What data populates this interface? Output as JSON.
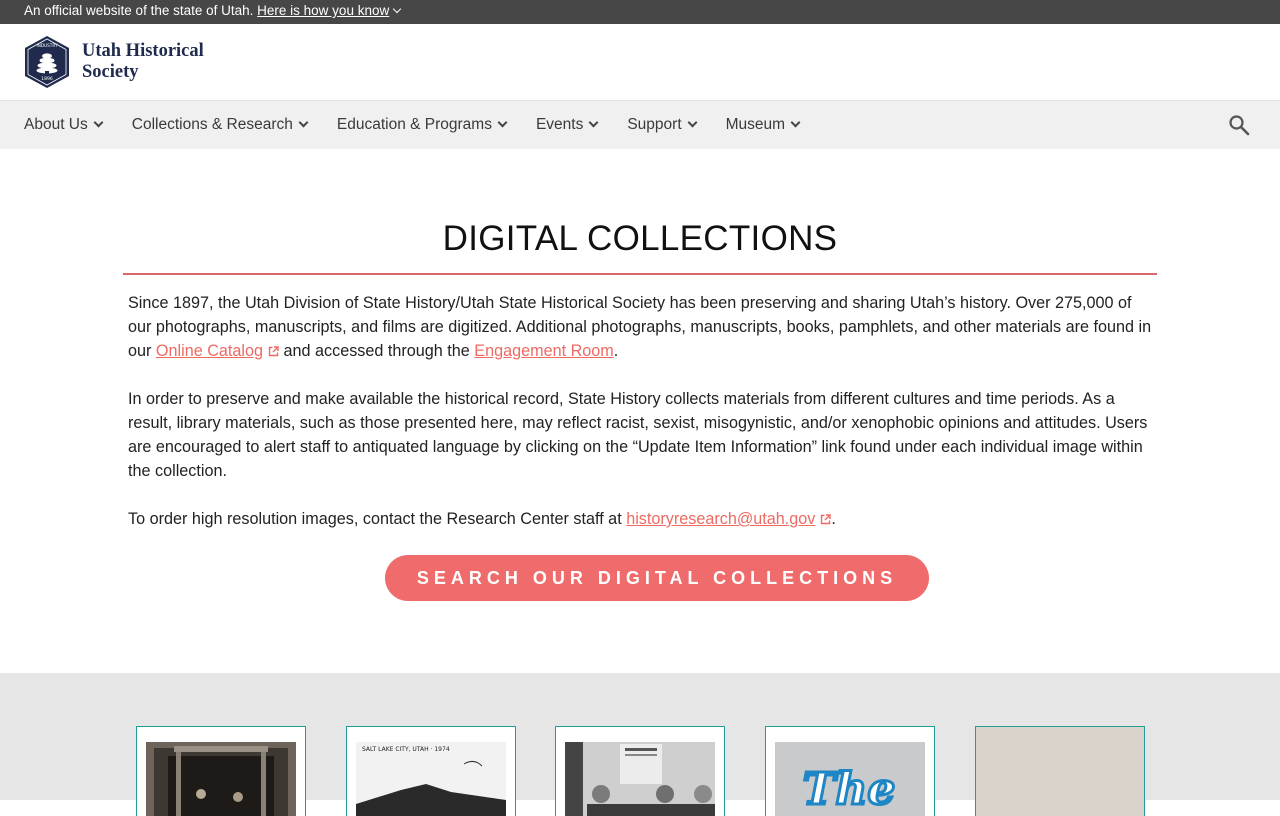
{
  "gov_banner": {
    "text": "An official website of the state of Utah.",
    "link": "Here is how you know"
  },
  "header": {
    "logo_line1": "Utah Historical",
    "logo_line2": "Society",
    "badge_top": "INDUSTRY",
    "badge_year": "1896"
  },
  "nav": {
    "items": [
      "About Us",
      "Collections & Research",
      "Education & Programs",
      "Events",
      "Support",
      "Museum"
    ],
    "search_icon": "search-icon"
  },
  "main": {
    "title": "DIGITAL COLLECTIONS",
    "p1_part1": "Since 1897, the Utah Division of State History/Utah State Historical Society has been preserving and sharing Utah’s history. Over 275,000 of our photographs, manuscripts, and films are digitized. Additional photographs, manuscripts, books, pamphlets, and other materials are found in our ",
    "p1_link1": "Online Catalog",
    "p1_part2": " and accessed through the ",
    "p1_link2": "Engagement Room",
    "p1_part3": ".",
    "p2": "In order to preserve and make available the historical record, State History collects materials from different cultures and time periods. As a result, library materials, such as those presented here, may reflect racist, sexist, misogynistic, and/or xenophobic opinions and attitudes. Users are encouraged to alert staff to antiquated language by clicking on the “Update Item Information” link found under each individual image within the collection.",
    "p3_part1": "To order high resolution images, contact the Research Center staff at ",
    "p3_link": "historyresearch@utah.gov",
    "p3_part2": ".",
    "cta": "SEARCH OUR DIGITAL COLLECTIONS"
  },
  "gallery": {
    "card2_caption": "SALT LAKE CITY, UTAH · 1974",
    "card4_text": "The"
  },
  "colors": {
    "accent": "#f06b6b",
    "rule": "#d9676a",
    "nav_bg": "#f0f0f0",
    "banner_bg": "#474747",
    "card_border": "#1f9c98",
    "navy": "#1f2a4d"
  }
}
